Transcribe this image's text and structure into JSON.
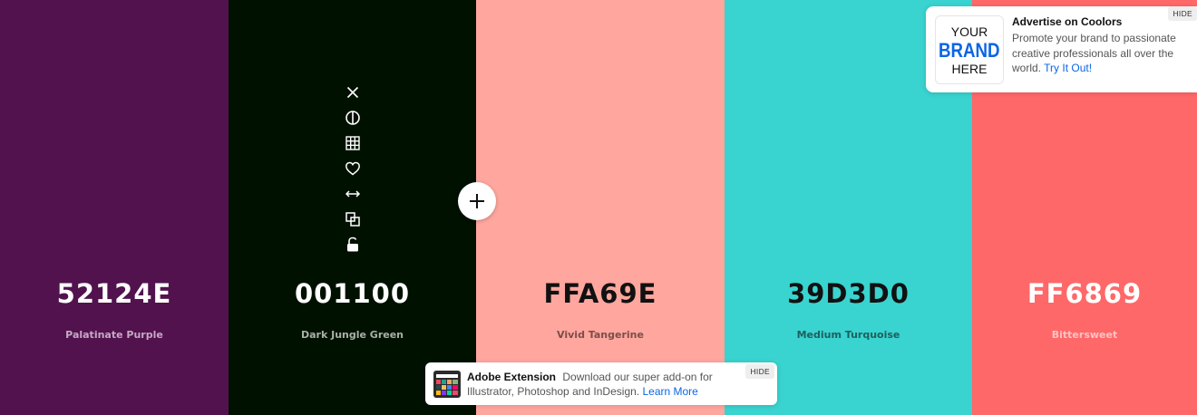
{
  "palette": {
    "swatches": [
      {
        "hex": "52124E",
        "name": "Palatinate Purple",
        "color": "#52124E",
        "hex_color": "#ffffff",
        "name_color": "#c6a8c4",
        "width": 252
      },
      {
        "hex": "001100",
        "name": "Dark Jungle Green",
        "color": "#001100",
        "hex_color": "#ffffff",
        "name_color": "#a9b0a9",
        "width": 273
      },
      {
        "hex": "FFA69E",
        "name": "Vivid Tangerine",
        "color": "#FFA69E",
        "hex_color": "#111111",
        "name_color": "#7a4e4a",
        "width": 274
      },
      {
        "hex": "39D3D0",
        "name": "Medium Turquoise",
        "color": "#39D3D0",
        "hex_color": "#111111",
        "name_color": "#1d5f5e",
        "width": 273
      },
      {
        "hex": "FF6869",
        "name": "Bittersweet",
        "color": "#FF6869",
        "hex_color": "#ffffff",
        "name_color": "#ffc2c2",
        "width": 248
      }
    ]
  },
  "toolbar": {
    "icons": [
      "close-icon",
      "contrast-icon",
      "shades-grid-icon",
      "heart-icon",
      "drag-arrows-icon",
      "copy-icon",
      "unlock-icon"
    ]
  },
  "ad": {
    "brand_line1": "YOUR",
    "brand_line2": "BRAND",
    "brand_line3": "HERE",
    "title": "Advertise on Coolors",
    "text": "Promote your brand to passionate creative professionals all over the world.",
    "link": "Try It Out!",
    "hide": "HIDE"
  },
  "extension": {
    "title": "Adobe Extension",
    "text": "Download our super add-on for Illustrator, Photoshop and InDesign.",
    "link": "Learn More",
    "hide": "HIDE"
  }
}
